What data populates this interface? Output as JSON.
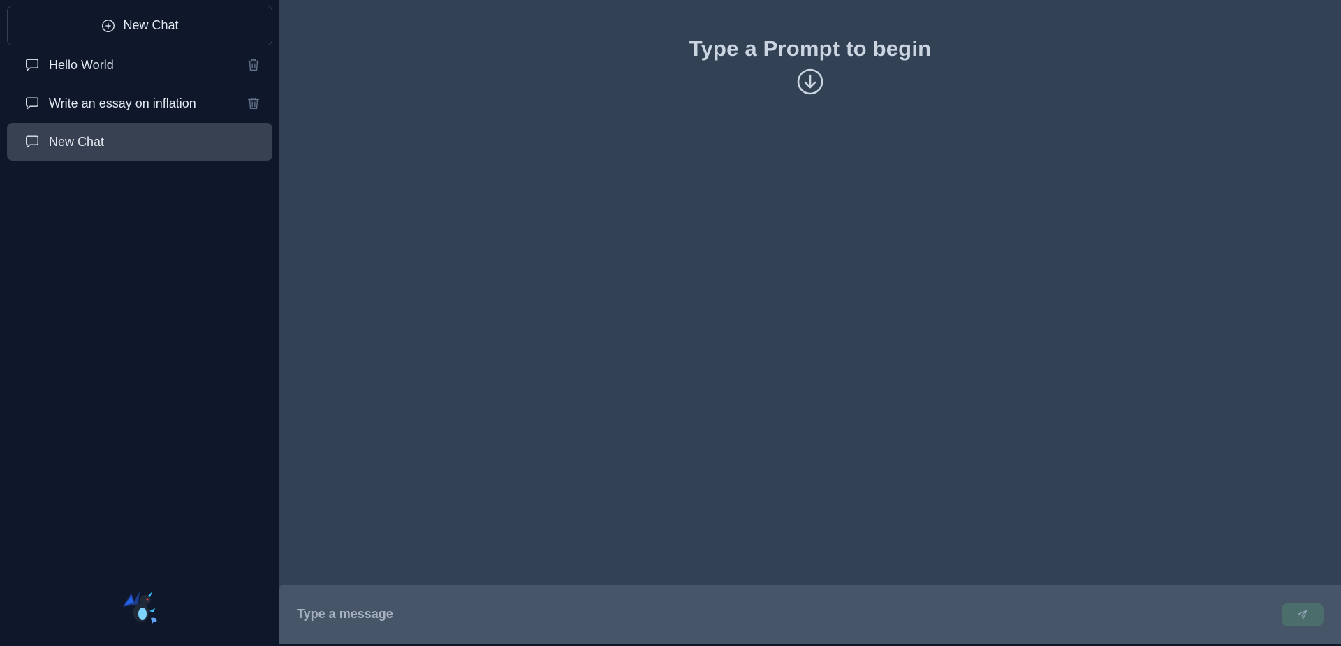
{
  "sidebar": {
    "new_chat_label": "New Chat",
    "items": [
      {
        "label": "Hello World",
        "active": false,
        "deletable": true
      },
      {
        "label": "Write an essay on inflation",
        "active": false,
        "deletable": true
      },
      {
        "label": "New Chat",
        "active": true,
        "deletable": false
      }
    ]
  },
  "main": {
    "prompt_title": "Type a Prompt to begin"
  },
  "composer": {
    "placeholder": "Type a message"
  },
  "icons": {
    "new_chat": "plus-circle-icon",
    "chat_item": "message-bubble-icon",
    "delete": "trash-icon",
    "prompt_arrow": "arrow-down-circle-icon",
    "send": "send-icon",
    "avatar": "dragon-avatar"
  },
  "colors": {
    "sidebar_bg": "#0f172a",
    "main_bg": "#334155",
    "composer_bg": "#475569",
    "active_item_bg": "#374151",
    "send_button_bg": "#4b6d6b",
    "text": "#e2e8f0",
    "title_text": "#cbd5e1"
  }
}
